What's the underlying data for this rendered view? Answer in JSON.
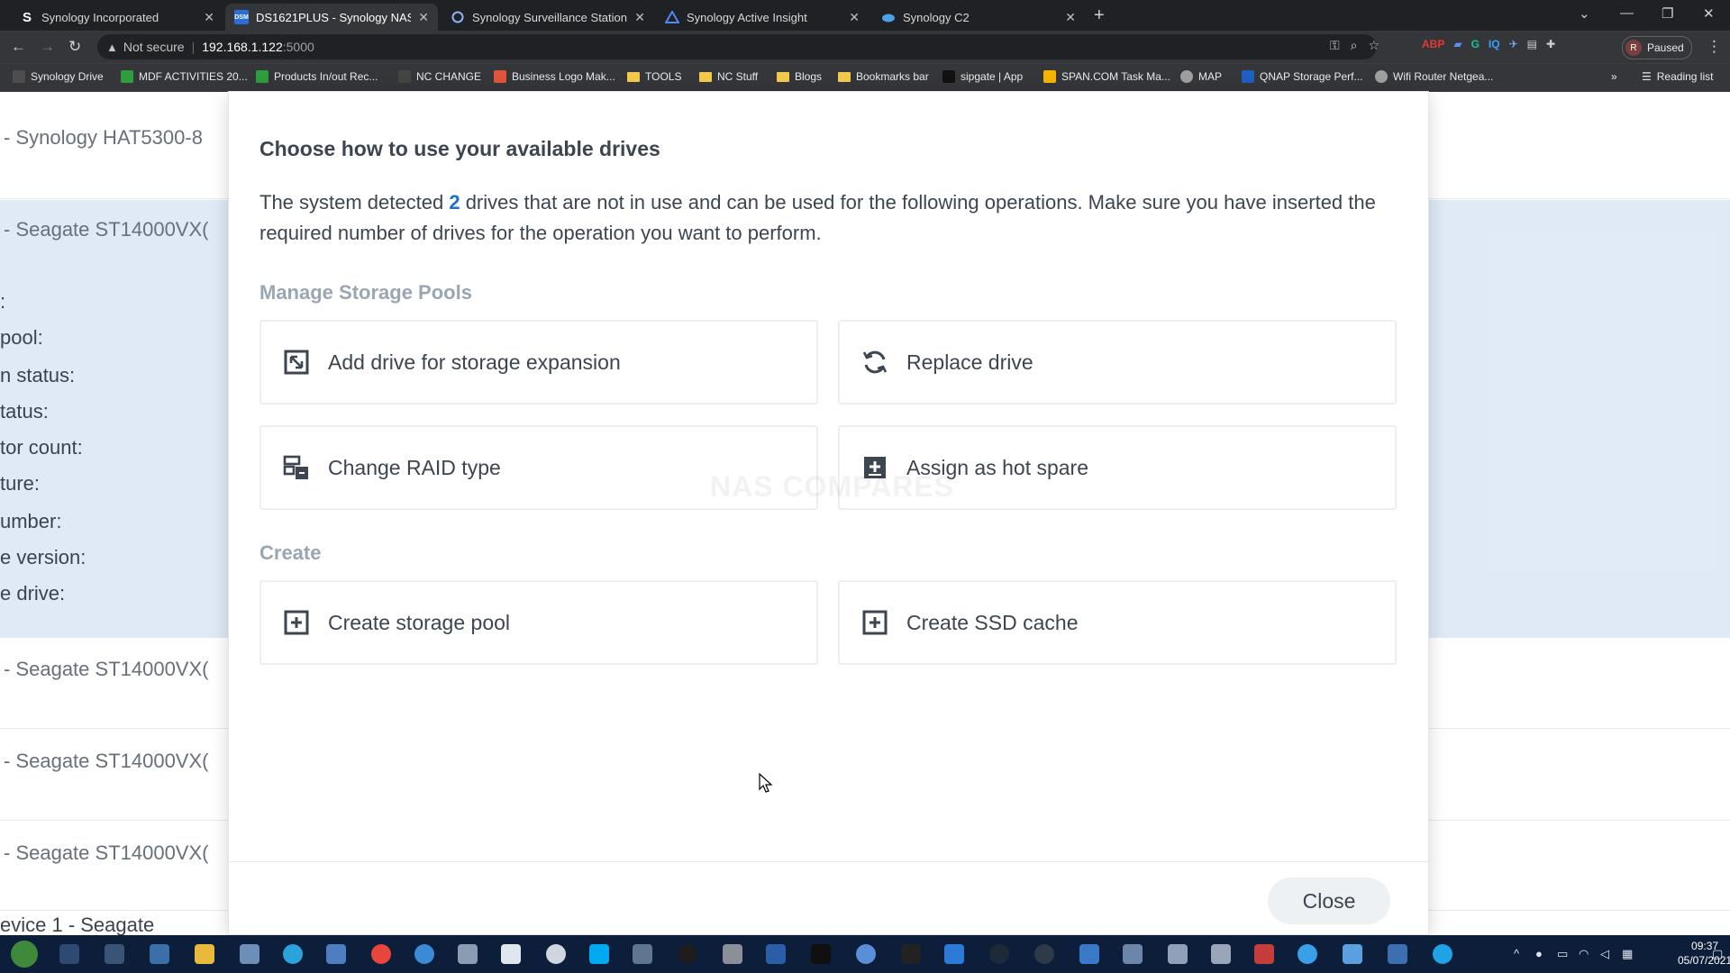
{
  "browser": {
    "tabs": [
      {
        "title": "Synology Incorporated",
        "favicon": "S"
      },
      {
        "title": "DS1621PLUS - Synology NAS",
        "favicon": "DSM"
      },
      {
        "title": "Synology Surveillance Station - D",
        "favicon": "shield"
      },
      {
        "title": "Synology Active Insight",
        "favicon": "A"
      },
      {
        "title": "Synology C2",
        "favicon": "cloud"
      }
    ],
    "security_label": "Not secure",
    "url_host": "192.168.1.122",
    "url_port": ":5000",
    "profile_label": "Paused",
    "profile_initial": "R",
    "reading_list": "Reading list",
    "bookmarks": [
      "Synology Drive",
      "MDF ACTIVITIES 20...",
      "Products In/out Rec...",
      "NC CHANGE",
      "Business Logo Mak...",
      "TOOLS",
      "NC Stuff",
      "Blogs",
      "Bookmarks bar",
      "sipgate | App",
      "SPAN.COM Task Ma...",
      "MAP",
      "QNAP Storage Perf...",
      "Wifi Router Netgea..."
    ]
  },
  "background": {
    "drives": [
      "- Synology HAT5300-8",
      "- Seagate ST14000VX(",
      "- Seagate ST14000VX(",
      "- Seagate ST14000VX(",
      "- Seagate ST14000VX("
    ],
    "properties": [
      ":",
      "pool:",
      "n status:",
      "tatus:",
      "tor count:",
      "ture:",
      "umber:",
      "e version:",
      "e drive:"
    ],
    "bottom_text": "evice 1 - Seagate"
  },
  "modal": {
    "title": "Choose how to use your available drives",
    "desc_before": "The system detected ",
    "desc_count": "2",
    "desc_after": " drives that are not in use and can be used for the following operations. Make sure you have inserted the required number of drives for the operation you want to perform.",
    "section_manage": "Manage Storage Pools",
    "section_create": "Create",
    "actions": {
      "add_drive": "Add drive for storage expansion",
      "replace_drive": "Replace drive",
      "change_raid": "Change RAID type",
      "hot_spare": "Assign as hot spare",
      "create_pool": "Create storage pool",
      "create_cache": "Create SSD cache"
    },
    "close_label": "Close",
    "watermark": "NAS COMPARES"
  },
  "taskbar": {
    "time": "09:37",
    "date": "05/07/2021"
  },
  "colors": {
    "accent": "#1a73c8",
    "selected_row": "#dde9f6",
    "taskbar": "#0c1e3a"
  }
}
